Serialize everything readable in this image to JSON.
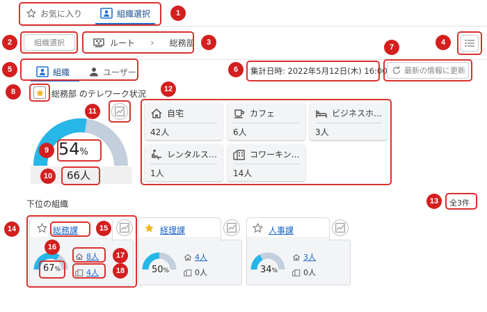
{
  "tabs": {
    "favorites_label": "お気に入り",
    "org_select_label": "組織選択"
  },
  "toolbar": {
    "org_select_button": "組織選択",
    "breadcrumb_root": "ルート",
    "breadcrumb_sep": "›",
    "breadcrumb_current": "総務部"
  },
  "view_tabs": {
    "org_label": "組織",
    "user_label": "ユーザー"
  },
  "aggregation": {
    "datetime_text": "集計日時: 2022年5月12日(木) 16:00",
    "refresh_label": "最新の情報に更新"
  },
  "status": {
    "title": "総務部 のテレワーク状況",
    "percent": "54",
    "percent_unit": "%",
    "gauge_fraction": 0.54,
    "people_count": "66人"
  },
  "locations": [
    {
      "name": "自宅",
      "count": "42人",
      "icon": "home-icon"
    },
    {
      "name": "カフェ",
      "count": "6人",
      "icon": "cafe-icon"
    },
    {
      "name": "ビジネスホ…",
      "count": "3人",
      "icon": "hotel-icon"
    },
    {
      "name": "レンタルス…",
      "count": "1人",
      "icon": "rental-space-icon"
    },
    {
      "name": "コワーキン…",
      "count": "14人",
      "icon": "coworking-icon"
    }
  ],
  "sub_orgs": {
    "heading": "下位の組織",
    "total": "全3件",
    "items": [
      {
        "name": "総務課",
        "percent": "67",
        "unit": "%",
        "fraction": 0.67,
        "home": "8人",
        "office": "4人",
        "favorite": false,
        "home_link": true,
        "office_link": true
      },
      {
        "name": "経理課",
        "percent": "50",
        "unit": "%",
        "fraction": 0.5,
        "home": "4人",
        "office": "0人",
        "favorite": true,
        "home_link": true,
        "office_link": false
      },
      {
        "name": "人事課",
        "percent": "34",
        "unit": "%",
        "fraction": 0.34,
        "home": "3人",
        "office": "0人",
        "favorite": false,
        "home_link": true,
        "office_link": false
      }
    ]
  },
  "badges": [
    "1",
    "2",
    "3",
    "4",
    "5",
    "6",
    "7",
    "8",
    "9",
    "10",
    "11",
    "12",
    "13",
    "14",
    "15",
    "16",
    "17",
    "18"
  ],
  "colors": {
    "accent": "#1e6fd0",
    "gauge_fill": "#27b6e8",
    "gauge_track": "#c3cfdc",
    "annotation": "#d41f1f",
    "star": "#f3b41b"
  }
}
